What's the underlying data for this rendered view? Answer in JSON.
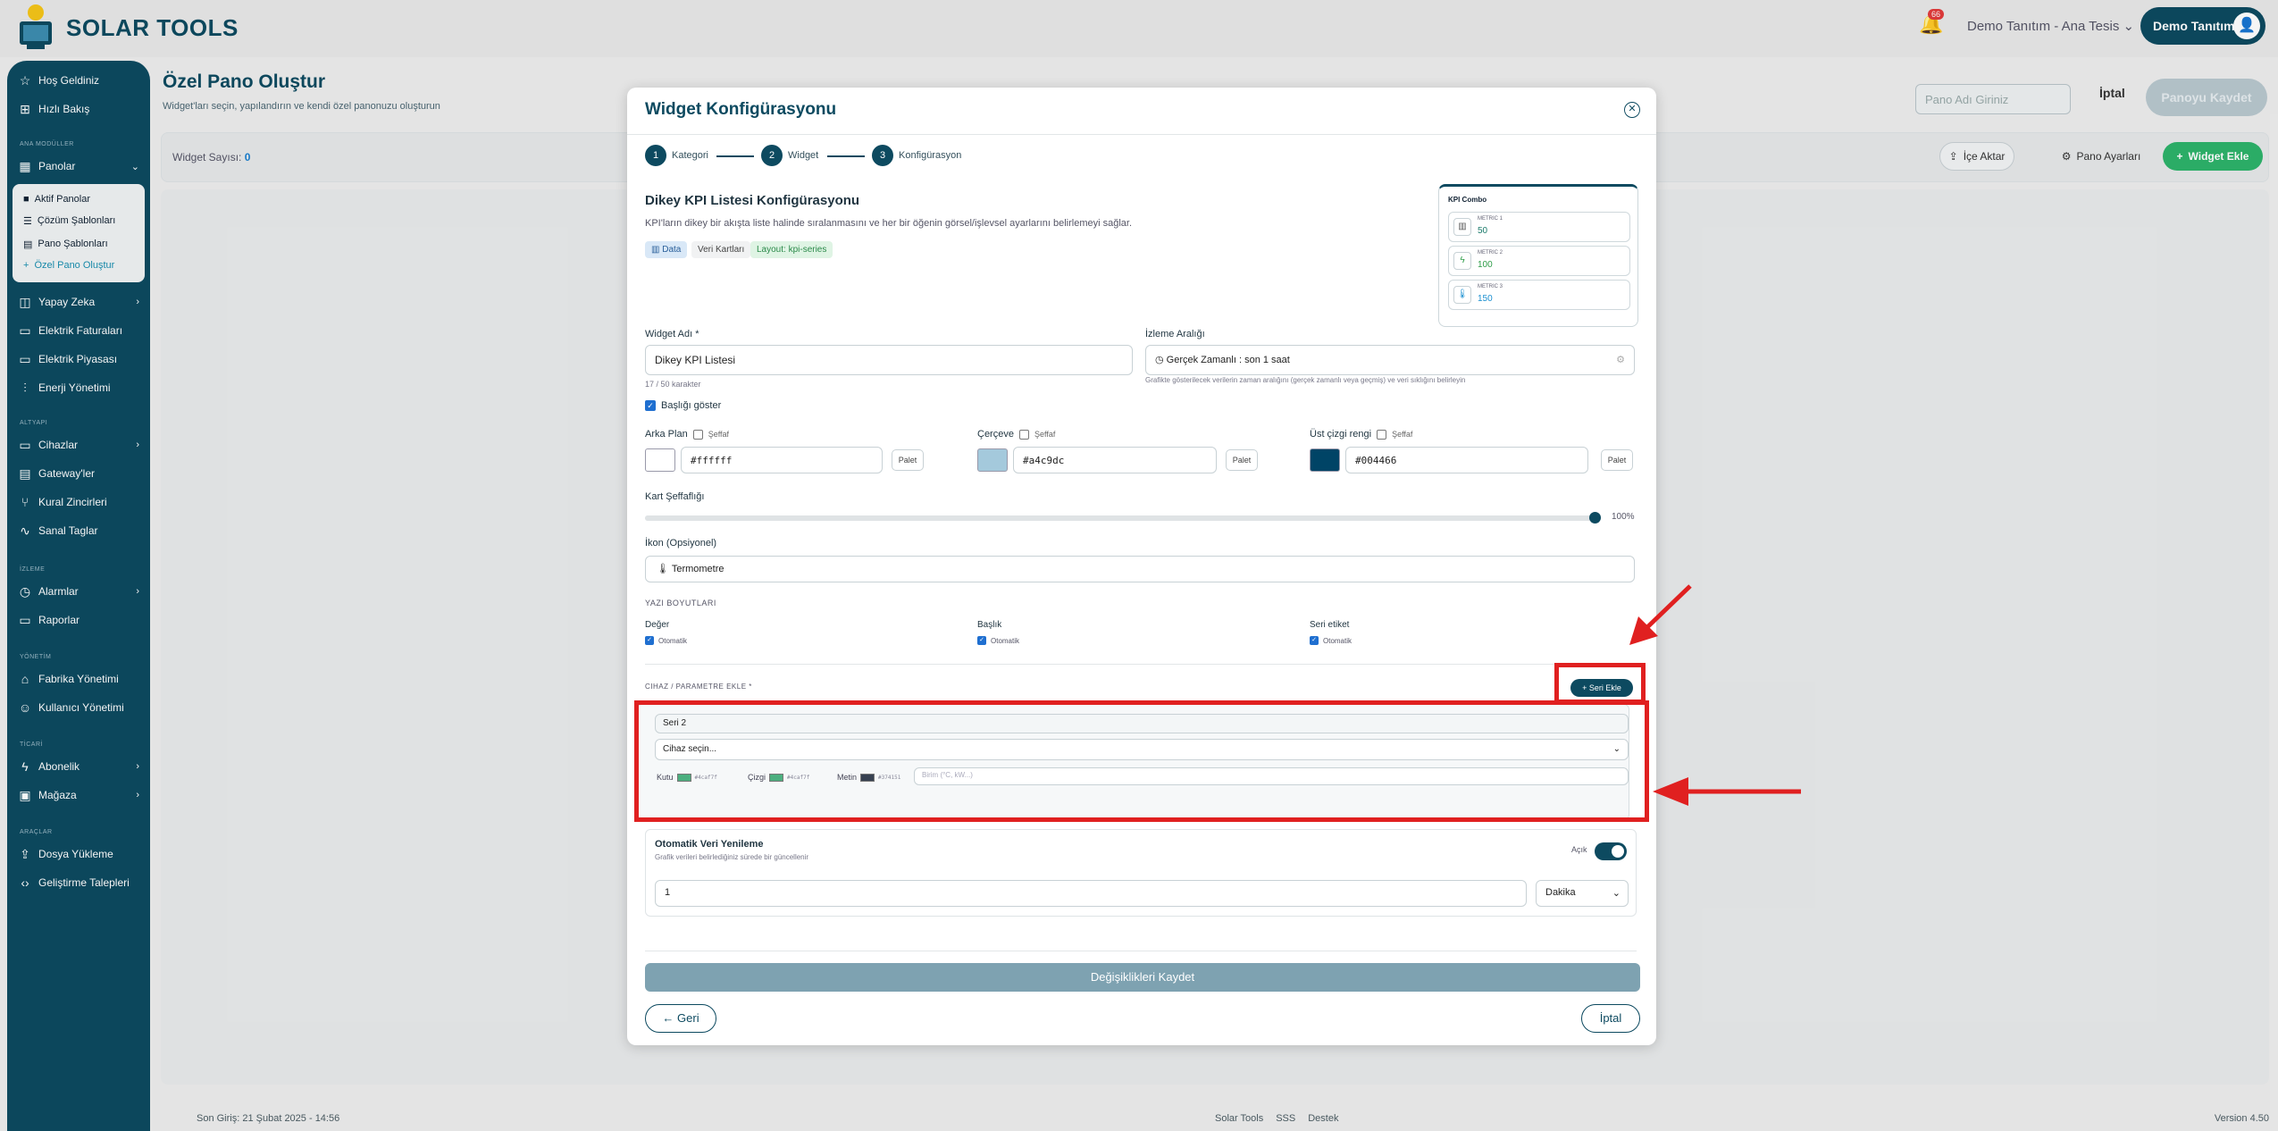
{
  "app": {
    "name": "SOLAR TOOLS"
  },
  "header": {
    "notification_count": "66",
    "tenant": "Demo Tanıtım - Ana Tesis",
    "user": "Demo Tanıtım"
  },
  "sidebar": {
    "top_items": [
      "Hoş Geldiniz",
      "Hızlı Bakış"
    ],
    "sections": {
      "ana_moduller": "ANA MODÜLLER",
      "altyapi": "ALTYAPI",
      "izleme": "İZLEME",
      "yonetim": "YÖNETİM",
      "ticari": "TİCARİ",
      "araclar": "ARAÇLAR"
    },
    "panolar": "Panolar",
    "sub_items": [
      "Aktif Panolar",
      "Çözüm Şablonları",
      "Pano Şablonları",
      "Özel Pano Oluştur"
    ],
    "items_a": [
      "Yapay Zeka",
      "Elektrik Faturaları",
      "Elektrik Piyasası",
      "Enerji Yönetimi"
    ],
    "items_b": [
      "Cihazlar",
      "Gateway'ler",
      "Kural Zincirleri",
      "Sanal Taglar"
    ],
    "items_c": [
      "Alarmlar",
      "Raporlar"
    ],
    "items_d": [
      "Fabrika Yönetimi",
      "Kullanıcı Yönetimi"
    ],
    "items_e": [
      "Abonelik",
      "Mağaza"
    ],
    "items_f": [
      "Dosya Yükleme",
      "Geliştirme Talepleri"
    ]
  },
  "page": {
    "title": "Özel Pano Oluştur",
    "subtitle": "Widget'ları seçin, yapılandırın ve kendi özel panonuzu oluşturun",
    "name_placeholder": "Pano Adı Giriniz",
    "cancel": "İptal",
    "save": "Panoyu Kaydet",
    "widget_count_label": "Widget Sayısı:",
    "widget_count": "0",
    "import": "İçe Aktar",
    "settings": "Pano Ayarları",
    "add_widget": "Widget Ekle"
  },
  "footer": {
    "last_login": "Son Giriş: 21 Şubat 2025 - 14:56",
    "links": [
      "Solar Tools",
      "SSS",
      "Destek"
    ],
    "version": "Version 4.50"
  },
  "modal": {
    "title": "Widget Konfigürasyonu",
    "steps": [
      {
        "num": "1",
        "label": "Kategori"
      },
      {
        "num": "2",
        "label": "Widget"
      },
      {
        "num": "3",
        "label": "Konfigürasyon"
      }
    ],
    "cfg_title": "Dikey KPI Listesi Konfigürasyonu",
    "cfg_desc": "KPI'ların dikey bir akışta liste halinde sıralanmasını ve her bir öğenin görsel/işlevsel ayarlarını belirlemeyi sağlar.",
    "tags": [
      "Data",
      "Veri Kartları",
      "Layout: kpi-series"
    ],
    "preview": {
      "title": "KPI Combo",
      "rows": [
        {
          "label": "METRIC 1",
          "value": "50",
          "color": "#1a7a6a"
        },
        {
          "label": "METRIC 2",
          "value": "100",
          "color": "#2d9c47"
        },
        {
          "label": "METRIC 3",
          "value": "150",
          "color": "#1a8fd0"
        }
      ]
    },
    "widget_name_label": "Widget Adı *",
    "widget_name": "Dikey KPI Listesi",
    "char_count": "17 / 50 karakter",
    "range_label": "İzleme Aralığı",
    "range_value": "Gerçek Zamanlı : son 1 saat",
    "range_hint": "Grafikte gösterilecek verilerin zaman aralığını (gerçek zamanlı veya geçmiş) ve veri sıklığını belirleyin",
    "show_title": "Başlığı göster",
    "colors": [
      {
        "label": "Arka Plan",
        "transparent": "Şeffaf",
        "hex": "#ffffff",
        "swatch": "#ffffff",
        "palet": "Palet"
      },
      {
        "label": "Çerçeve",
        "transparent": "Şeffaf",
        "hex": "#a4c9dc",
        "swatch": "#a4c9dc",
        "palet": "Palet"
      },
      {
        "label": "Üst çizgi rengi",
        "transparent": "Şeffaf",
        "hex": "#004466",
        "swatch": "#004466",
        "palet": "Palet"
      }
    ],
    "opacity_label": "Kart Şeffaflığı",
    "opacity_value": "100%",
    "opacity_fraction": 1.0,
    "icon_label": "İkon (Opsiyonel)",
    "icon_value": "Termometre",
    "font_sizes_label": "YAZI BOYUTLARI",
    "font_sizes": [
      {
        "label": "Değer",
        "auto": "Otomatik"
      },
      {
        "label": "Başlık",
        "auto": "Otomatik"
      },
      {
        "label": "Seri etiket",
        "auto": "Otomatik"
      }
    ],
    "device_param_label": "CIHAZ / PARAMETRE EKLE *",
    "add_series": "Seri Ekle",
    "series": {
      "name": "Seri 2",
      "device_placeholder": "Cihaz seçin...",
      "box_label": "Kutu",
      "box_hex": "#4caf7f",
      "line_label": "Çizgi",
      "line_hex": "#4caf7f",
      "text_label": "Metin",
      "text_hex": "#374151",
      "unit_placeholder": "Birim (°C, kW...)"
    },
    "auto_refresh": {
      "title": "Otomatik Veri Yenileme",
      "desc": "Grafik verileri belirlediğiniz sürede bir güncellenir",
      "state": "Açık",
      "value": "1",
      "unit": "Dakika"
    },
    "save_changes": "Değişiklikleri Kaydet",
    "back": "← Geri",
    "cancel": "İptal"
  },
  "colors": {
    "primary": "#0d4a60",
    "accent_green": "#2db36b",
    "annotation_red": "#e02020"
  }
}
